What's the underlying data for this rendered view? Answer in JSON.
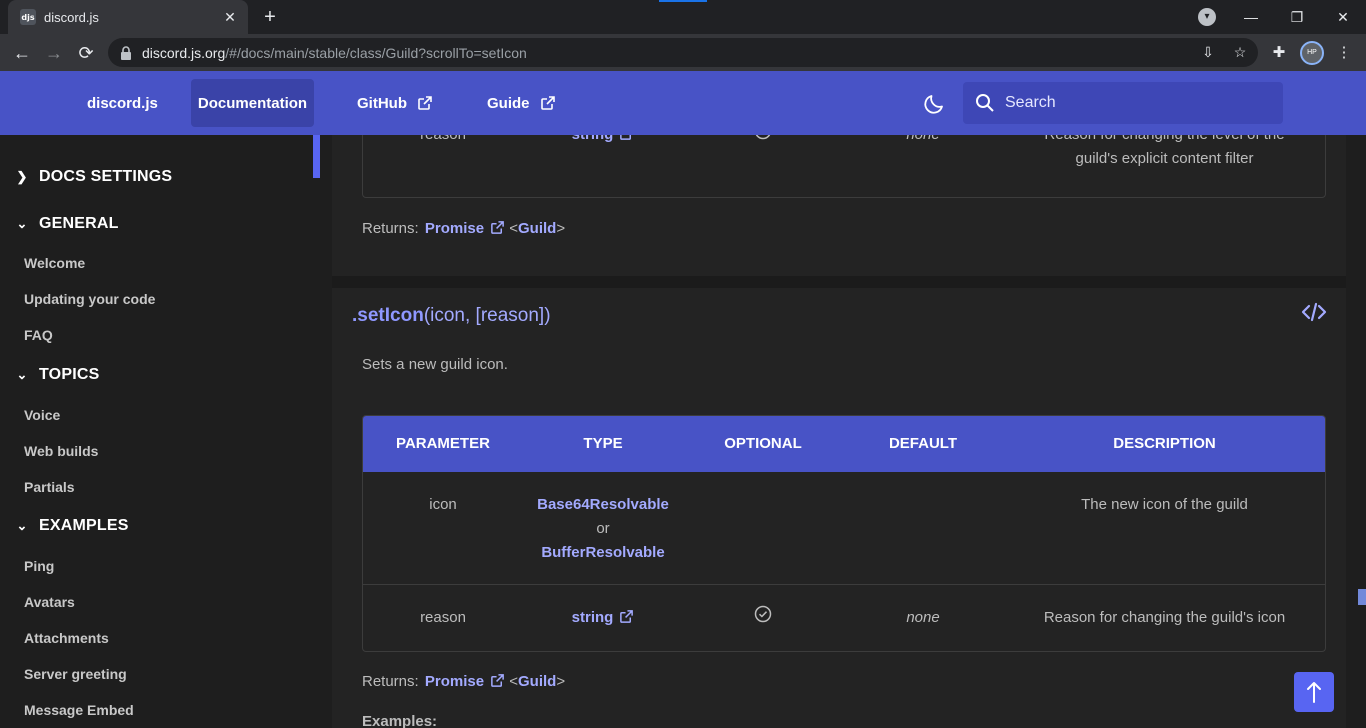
{
  "browser": {
    "tab_title": "discord.js",
    "tab_favicon_text": "djs",
    "url_host": "discord.js.org",
    "url_path": "/#/docs/main/stable/class/Guild?scrollTo=setIcon",
    "profile_text": "HP"
  },
  "navbar": {
    "brand": "discord.js",
    "links": [
      {
        "label": "Documentation"
      },
      {
        "label": "GitHub"
      },
      {
        "label": "Guide"
      }
    ],
    "search_placeholder": "Search"
  },
  "sidebar": {
    "sections": [
      {
        "label": "DOCS SETTINGS",
        "expanded": false
      },
      {
        "label": "GENERAL",
        "expanded": true,
        "items": [
          "Welcome",
          "Updating your code",
          "FAQ"
        ]
      },
      {
        "label": "TOPICS",
        "expanded": true,
        "items": [
          "Voice",
          "Web builds",
          "Partials"
        ]
      },
      {
        "label": "EXAMPLES",
        "expanded": true,
        "items": [
          "Ping",
          "Avatars",
          "Attachments",
          "Server greeting",
          "Message Embed"
        ]
      }
    ]
  },
  "prev_method": {
    "row": {
      "param": "reason",
      "type": "string",
      "default": "none",
      "desc_line1": "Reason for changing the level of the",
      "desc_line2": "guild's explicit content filter"
    },
    "returns_label": "Returns:",
    "returns_type": "Promise",
    "returns_generic": "Guild"
  },
  "method": {
    "name": ".setIcon",
    "args": "(icon, [reason])",
    "description": "Sets a new guild icon.",
    "table": {
      "headers": [
        "PARAMETER",
        "TYPE",
        "OPTIONAL",
        "DEFAULT",
        "DESCRIPTION"
      ],
      "rows": [
        {
          "param": "icon",
          "type1": "Base64Resolvable",
          "or": "or",
          "type2": "BufferResolvable",
          "desc": "The new icon of the guild"
        },
        {
          "param": "reason",
          "type": "string",
          "default": "none",
          "desc": "Reason for changing the guild's icon"
        }
      ]
    },
    "returns_label": "Returns:",
    "returns_type": "Promise",
    "returns_generic": "Guild",
    "examples_label": "Examples:"
  }
}
